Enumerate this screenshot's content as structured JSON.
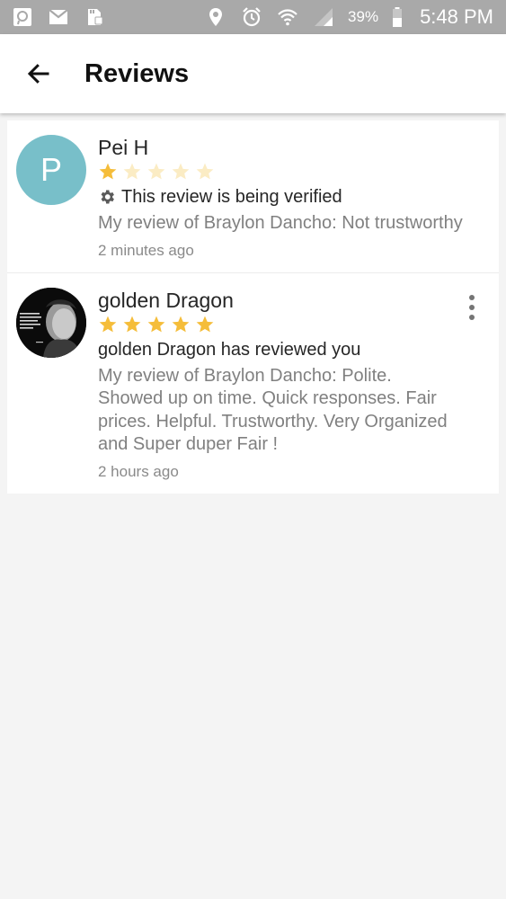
{
  "status_bar": {
    "battery_percent": "39%",
    "time": "5:48 PM",
    "icons": [
      "app-notification-icon",
      "gmail-icon",
      "sd-card-icon",
      "location-icon",
      "alarm-icon",
      "wifi-icon",
      "signal-icon",
      "battery-icon"
    ]
  },
  "app_bar": {
    "title": "Reviews",
    "back_icon": "arrow-back-icon"
  },
  "reviews": [
    {
      "avatar_letter": "P",
      "avatar_color": "#78bfc9",
      "name": "Pei H",
      "rating": 1,
      "max_rating": 5,
      "headline": "This review is being verified",
      "headline_icon": "gear-icon",
      "text": "My review of Braylon Dancho: Not trustworthy",
      "time": "2 minutes ago"
    },
    {
      "avatar_photo": "profile-photo",
      "name": "golden Dragon",
      "rating": 5,
      "max_rating": 5,
      "headline": "golden Dragon has reviewed you",
      "text": "My review of Braylon Dancho: Polite. Showed up on time. Quick responses. Fair prices. Helpful. Trustworthy. Very Organized and Super duper Fair !",
      "time": "2 hours ago",
      "menu_icon": "more-vert-icon"
    }
  ],
  "colors": {
    "star_filled": "#f5bd3a",
    "star_empty": "#fbecc4",
    "status_bar": "#a9a9a9"
  }
}
